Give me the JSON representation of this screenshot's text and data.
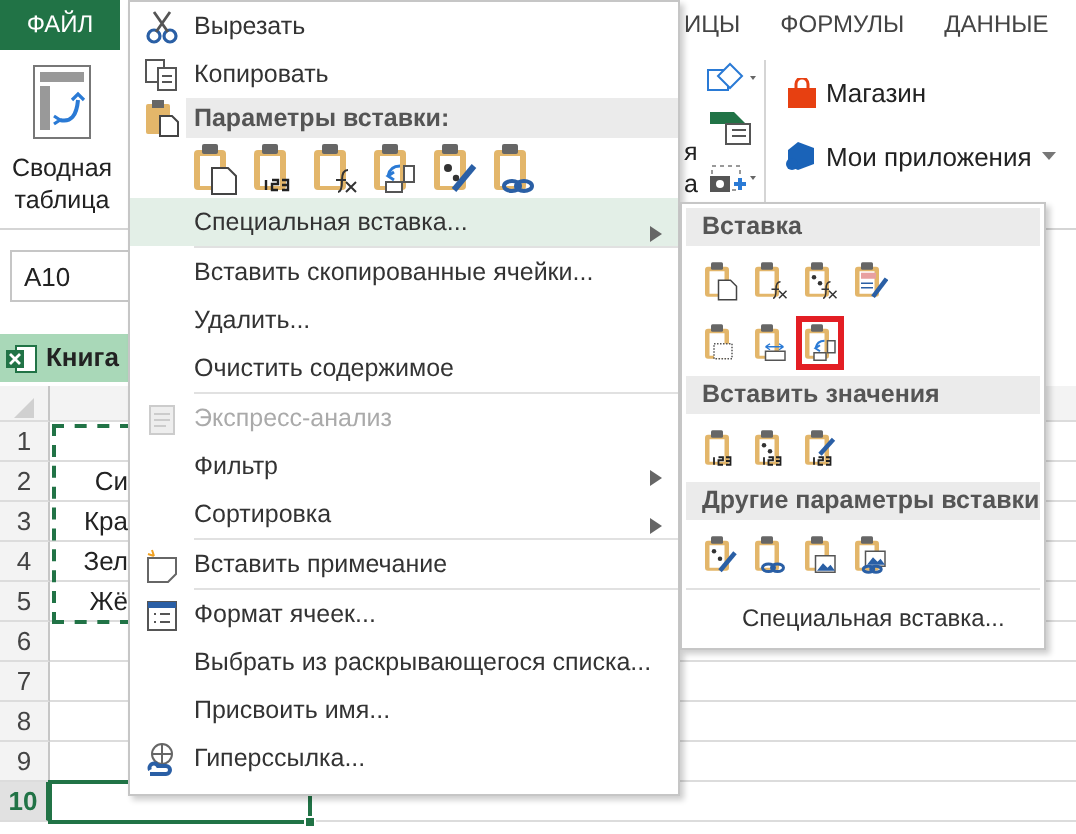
{
  "ribbon_tabs": [
    {
      "label": "ФАЙЛ",
      "kind": "file"
    },
    {
      "label": "ИЦЫ",
      "kind": "tab"
    },
    {
      "label": "ФОРМУЛЫ",
      "kind": "tab"
    },
    {
      "label": "ДАННЫЕ",
      "kind": "tab"
    }
  ],
  "ribbon": {
    "pivot_label": [
      "Сводная",
      "таблица"
    ],
    "cut_label_2": [
      "я",
      "а"
    ],
    "store": "Магазин",
    "my_apps": "Мои приложения"
  },
  "name_box": "A10",
  "workbook_tab": "Книга",
  "grid_rows": [
    {
      "label": "1",
      "cell": "",
      "selected": false
    },
    {
      "label": "2",
      "cell": "Си",
      "selected": false
    },
    {
      "label": "3",
      "cell": "Кра",
      "selected": false
    },
    {
      "label": "4",
      "cell": "Зел",
      "selected": false
    },
    {
      "label": "5",
      "cell": "Жё",
      "selected": false
    },
    {
      "label": "6",
      "cell": "",
      "selected": false
    },
    {
      "label": "7",
      "cell": "",
      "selected": false
    },
    {
      "label": "8",
      "cell": "",
      "selected": false
    },
    {
      "label": "9",
      "cell": "",
      "selected": false
    },
    {
      "label": "10",
      "cell": "",
      "selected": true
    }
  ],
  "context_menu": [
    {
      "kind": "item",
      "label": "Вырезать",
      "disabled": false,
      "submenu": false,
      "selected": false
    },
    {
      "kind": "item",
      "label": "Копировать",
      "disabled": false,
      "submenu": false,
      "selected": false
    },
    {
      "kind": "header",
      "label": "Параметры вставки:"
    },
    {
      "kind": "paste_row"
    },
    {
      "kind": "item",
      "label": "Специальная вставка...",
      "disabled": false,
      "submenu": true,
      "selected": true
    },
    {
      "kind": "separator"
    },
    {
      "kind": "item",
      "label": "Вставить скопированные ячейки...",
      "disabled": false,
      "submenu": false,
      "selected": false
    },
    {
      "kind": "item",
      "label": "Удалить...",
      "disabled": false,
      "submenu": false,
      "selected": false
    },
    {
      "kind": "item",
      "label": "Очистить содержимое",
      "disabled": false,
      "submenu": false,
      "selected": false
    },
    {
      "kind": "separator"
    },
    {
      "kind": "item",
      "label": "Экспресс-анализ",
      "disabled": true,
      "submenu": false,
      "selected": false
    },
    {
      "kind": "item",
      "label": "Фильтр",
      "disabled": false,
      "submenu": true,
      "selected": false
    },
    {
      "kind": "item",
      "label": "Сортировка",
      "disabled": false,
      "submenu": true,
      "selected": false
    },
    {
      "kind": "separator"
    },
    {
      "kind": "item",
      "label": "Вставить примечание",
      "disabled": false,
      "submenu": false,
      "selected": false
    },
    {
      "kind": "separator"
    },
    {
      "kind": "item",
      "label": "Формат ячеек...",
      "disabled": false,
      "submenu": false,
      "selected": false
    },
    {
      "kind": "item",
      "label": "Выбрать из раскрывающегося списка...",
      "disabled": false,
      "submenu": false,
      "selected": false
    },
    {
      "kind": "item",
      "label": "Присвоить имя...",
      "disabled": false,
      "submenu": false,
      "selected": false
    },
    {
      "kind": "item",
      "label": "Гиперссылка...",
      "disabled": false,
      "submenu": false,
      "selected": false
    }
  ],
  "paste_submenu": {
    "sections": [
      {
        "title": "Вставка",
        "rows": [
          [
            {
              "framed": false
            },
            {
              "framed": false
            },
            {
              "framed": false
            },
            {
              "framed": false
            }
          ],
          [
            {
              "framed": false
            },
            {
              "framed": false
            },
            {
              "framed": true
            }
          ]
        ]
      },
      {
        "title": "Вставить значения",
        "rows": [
          [
            {
              "framed": false
            },
            {
              "framed": false
            },
            {
              "framed": false
            }
          ]
        ]
      },
      {
        "title": "Другие параметры вставки",
        "rows": [
          [
            {
              "framed": false
            },
            {
              "framed": false
            },
            {
              "framed": false
            },
            {
              "framed": false
            }
          ]
        ]
      }
    ],
    "footer": "Специальная вставка..."
  }
}
